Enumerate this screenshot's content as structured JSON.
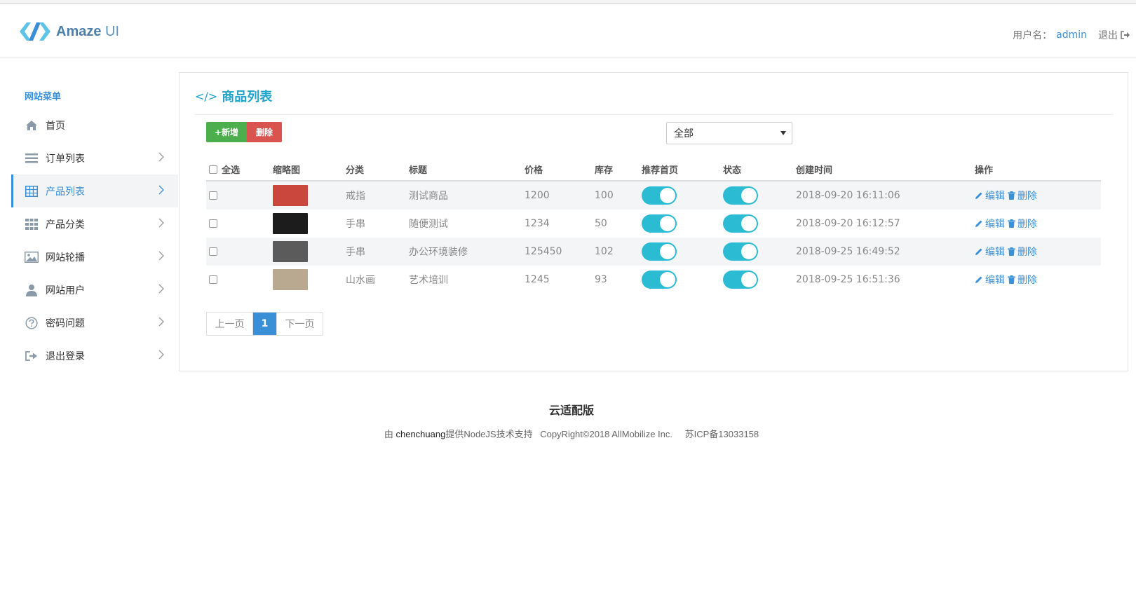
{
  "header": {
    "logo_brand": "Amaze",
    "logo_suffix": " UI",
    "username_label": "用户名：",
    "username": "admin",
    "logout_label": "退出"
  },
  "sidebar": {
    "title": "网站菜单",
    "items": [
      {
        "label": "首页",
        "icon": "home-icon",
        "chevron": false
      },
      {
        "label": "订单列表",
        "icon": "list-icon",
        "chevron": true
      },
      {
        "label": "产品列表",
        "icon": "table-icon",
        "chevron": true,
        "active": true
      },
      {
        "label": "产品分类",
        "icon": "grid-icon",
        "chevron": true
      },
      {
        "label": "网站轮播",
        "icon": "image-icon",
        "chevron": true
      },
      {
        "label": "网站用户",
        "icon": "user-icon",
        "chevron": true
      },
      {
        "label": "密码问题",
        "icon": "question-icon",
        "chevron": true
      },
      {
        "label": "退出登录",
        "icon": "sign-out-icon",
        "chevron": true
      }
    ]
  },
  "main": {
    "title": "商品列表",
    "add_button": "+新增",
    "delete_button": "删除",
    "filter_selected": "全部",
    "table": {
      "headers": [
        "全选",
        "缩略图",
        "分类",
        "标题",
        "价格",
        "库存",
        "推荐首页",
        "状态",
        "创建时间",
        "操作"
      ],
      "rows": [
        {
          "category": "戒指",
          "title": "测试商品",
          "price": "1200",
          "stock": "100",
          "recommend": true,
          "status": true,
          "created": "2018-09-20 16:11:06",
          "thumb_color": "#c9473d"
        },
        {
          "category": "手串",
          "title": "随便测试",
          "price": "1234",
          "stock": "50",
          "recommend": true,
          "status": true,
          "created": "2018-09-20 16:12:57",
          "thumb_color": "#1c1c1c"
        },
        {
          "category": "手串",
          "title": "办公环境装修",
          "price": "125450",
          "stock": "102",
          "recommend": true,
          "status": true,
          "created": "2018-09-25 16:49:52",
          "thumb_color": "#5b5b5b"
        },
        {
          "category": "山水画",
          "title": "艺术培训",
          "price": "1245",
          "stock": "93",
          "recommend": true,
          "status": true,
          "created": "2018-09-25 16:51:36",
          "thumb_color": "#b8a990"
        }
      ],
      "edit_label": "编辑",
      "delete_label": "删除"
    },
    "pagination": {
      "prev": "上一页",
      "current": "1",
      "next": "下一页"
    }
  },
  "footer": {
    "title": "云适配版",
    "support_prefix": "由",
    "support_name": "chenchuang",
    "support_suffix": "提供NodeJS技术支持",
    "copyright": "CopyRight©2018 AllMobilize Inc.",
    "icp": "苏ICP备13033158"
  },
  "colors": {
    "accent": "#3a8fd6",
    "title": "#1fa3c9",
    "toggle_on": "#2bbcd4",
    "add_button": "#4cae4c",
    "delete_button": "#d9534f"
  }
}
